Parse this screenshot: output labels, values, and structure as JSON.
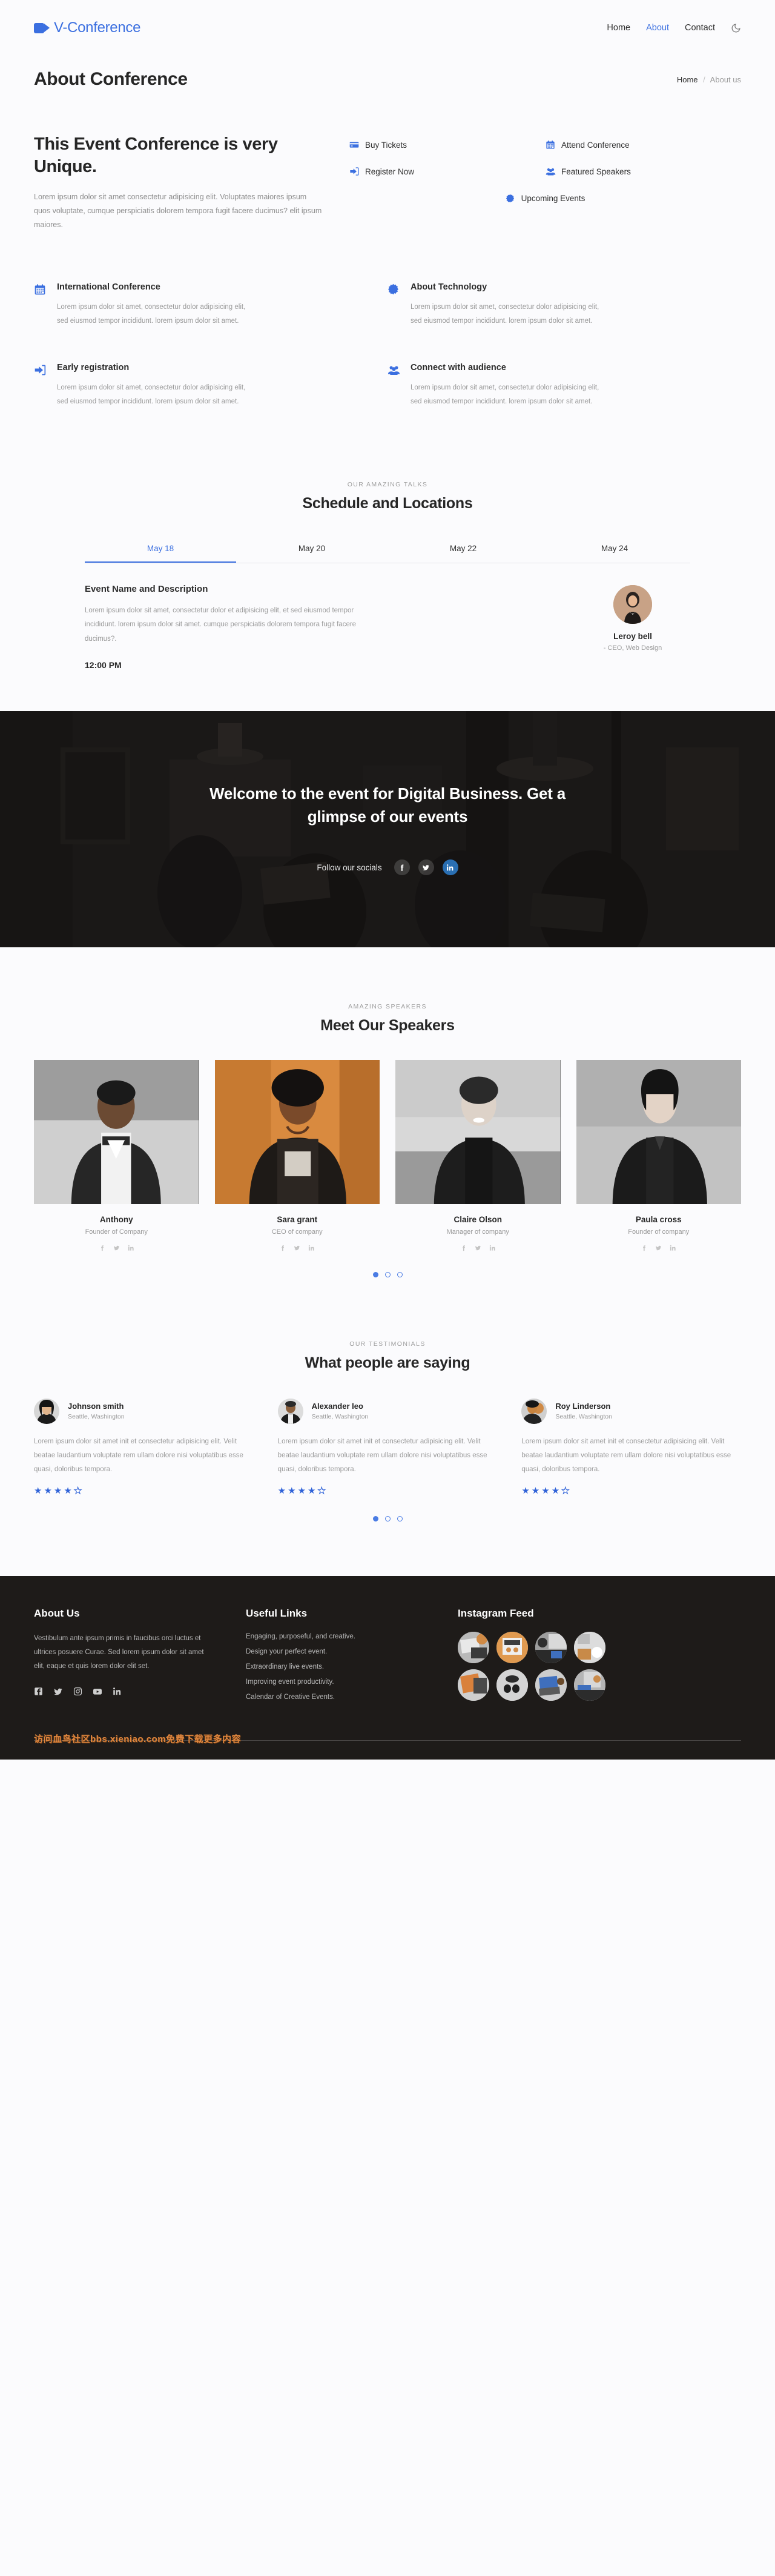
{
  "nav": {
    "brand": "V-Conference",
    "brand_icon": "video-camera-icon",
    "links": [
      {
        "label": "Home",
        "active": false
      },
      {
        "label": "About",
        "active": true
      },
      {
        "label": "Contact",
        "active": false
      }
    ],
    "theme_toggle_icon": "moon-icon"
  },
  "page_header": {
    "title": "About Conference",
    "breadcrumb_home": "Home",
    "breadcrumb_sep": "/",
    "breadcrumb_current": "About us"
  },
  "hero": {
    "title": "This Event Conference is very Unique.",
    "paragraph": "Lorem ipsum dolor sit amet consectetur adipisicing elit. Voluptates maiores ipsum quos voluptate, cumque perspiciatis dolorem tempora fugit facere ducimus? elit ipsum maiores.",
    "chips": [
      {
        "label": "Buy Tickets",
        "icon": "credit-card-icon"
      },
      {
        "label": "Attend Conference",
        "icon": "calendar-icon"
      },
      {
        "label": "Register Now",
        "icon": "sign-in-icon"
      },
      {
        "label": "Featured Speakers",
        "icon": "users-icon"
      },
      {
        "label": "Upcoming Events",
        "icon": "certificate-icon"
      }
    ]
  },
  "features": [
    {
      "icon": "calendar-icon",
      "title": "International Conference",
      "text": "Lorem ipsum dolor sit amet, consectetur dolor adipisicing elit, sed eiusmod tempor incididunt. lorem ipsum dolor sit amet."
    },
    {
      "icon": "certificate-icon",
      "title": "About Technology",
      "text": "Lorem ipsum dolor sit amet, consectetur dolor adipisicing elit, sed eiusmod tempor incididunt. lorem ipsum dolor sit amet."
    },
    {
      "icon": "sign-in-icon",
      "title": "Early registration",
      "text": "Lorem ipsum dolor sit amet, consectetur dolor adipisicing elit, sed eiusmod tempor incididunt. lorem ipsum dolor sit amet."
    },
    {
      "icon": "users-icon",
      "title": "Connect with audience",
      "text": "Lorem ipsum dolor sit amet, consectetur dolor adipisicing elit, sed eiusmod tempor incididunt. lorem ipsum dolor sit amet."
    }
  ],
  "schedule": {
    "eyebrow": "OUR AMAZING TALKS",
    "title": "Schedule and Locations",
    "tabs": [
      {
        "label": "May 18",
        "active": true
      },
      {
        "label": "May 20",
        "active": false
      },
      {
        "label": "May 22",
        "active": false
      },
      {
        "label": "May 24",
        "active": false
      }
    ],
    "event_title": "Event Name and Description",
    "event_text": "Lorem ipsum dolor sit amet, consectetur dolor et adipisicing elit, et sed eiusmod tempor incididunt. lorem ipsum dolor sit amet. cumque perspiciatis dolorem tempora fugit facere ducimus?.",
    "event_time": "12:00 PM",
    "speaker_name": "Leroy bell",
    "speaker_role": "- CEO, Web Design"
  },
  "banner": {
    "headline": "Welcome to the event for Digital Business. Get a glimpse of our events",
    "follow_label": "Follow our socials",
    "socials": [
      {
        "icon": "facebook-icon",
        "highlight": false
      },
      {
        "icon": "twitter-icon",
        "highlight": false
      },
      {
        "icon": "linkedin-icon",
        "highlight": true
      }
    ]
  },
  "speakers_section": {
    "eyebrow": "AMAZING SPEAKERS",
    "title": "Meet Our Speakers",
    "cards": [
      {
        "name": "Anthony",
        "role": "Founder of Company"
      },
      {
        "name": "Sara grant",
        "role": "CEO of company"
      },
      {
        "name": "Claire Olson",
        "role": "Manager of company"
      },
      {
        "name": "Paula cross",
        "role": "Founder of company"
      }
    ],
    "social_icons": [
      "facebook-icon",
      "twitter-icon",
      "linkedin-icon"
    ],
    "dots": [
      true,
      false,
      false
    ]
  },
  "testimonials_section": {
    "eyebrow": "OUR TESTIMONIALS",
    "title": "What people are saying",
    "cards": [
      {
        "name": "Johnson smith",
        "location": "Seattle, Washington",
        "text": "Lorem ipsum dolor sit amet init et consectetur adipisicing elit. Velit beatae laudantium voluptate rem ullam dolore nisi voluptatibus esse quasi, doloribus tempora.",
        "rating": 4,
        "max_rating": 5
      },
      {
        "name": "Alexander leo",
        "location": "Seattle, Washington",
        "text": "Lorem ipsum dolor sit amet init et consectetur adipisicing elit. Velit beatae laudantium voluptate rem ullam dolore nisi voluptatibus esse quasi, doloribus tempora.",
        "rating": 4,
        "max_rating": 5
      },
      {
        "name": "Roy Linderson",
        "location": "Seattle, Washington",
        "text": "Lorem ipsum dolor sit amet init et consectetur adipisicing elit. Velit beatae laudantium voluptate rem ullam dolore nisi voluptatibus esse quasi, doloribus tempora.",
        "rating": 4,
        "max_rating": 5
      }
    ],
    "dots": [
      true,
      false,
      false
    ]
  },
  "footer": {
    "about_title": "About Us",
    "about_text": "Vestibulum ante ipsum primis in faucibus orci luctus et ultrices posuere Curae. Sed lorem ipsum dolor sit amet elit, eaque et quis lorem dolor elit set.",
    "about_socials": [
      "facebook-icon",
      "twitter-icon",
      "instagram-icon",
      "youtube-icon",
      "linkedin-icon"
    ],
    "links_title": "Useful Links",
    "links": [
      "Engaging, purposeful, and creative.",
      "Design your perfect event.",
      "Extraordinary live events.",
      "Improving event productivity.",
      "Calendar of Creative Events."
    ],
    "instagram_title": "Instagram Feed",
    "instagram_count": 8,
    "watermark": "访问血鸟社区bbs.xieniao.com免费下载更多内容"
  },
  "colors": {
    "accent": "#3b6fe0",
    "dot": "#4a7ce4",
    "star": "#2f62d8",
    "page_bg": "#fbfbfd",
    "footer_bg": "#1e1b19",
    "watermark": "#e0873f"
  }
}
